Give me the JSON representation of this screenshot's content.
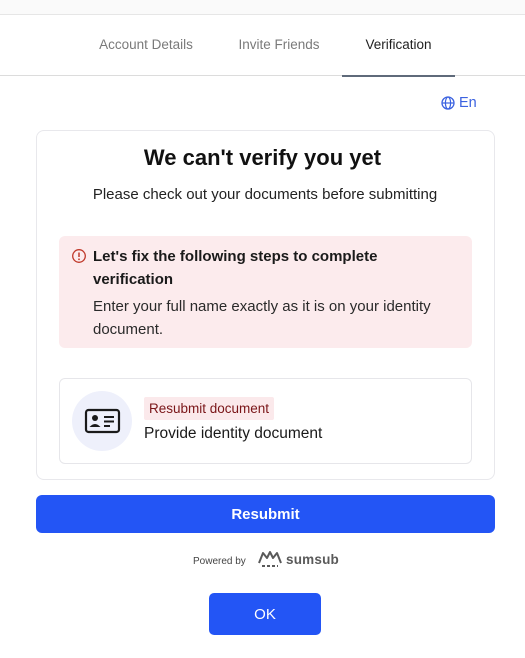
{
  "tabs": [
    {
      "label": "Account Details",
      "active": false
    },
    {
      "label": "Invite Friends",
      "active": false
    },
    {
      "label": "Verification",
      "active": true
    }
  ],
  "language": {
    "icon": "globe-icon",
    "label": "En"
  },
  "status": {
    "title": "We can't verify you yet",
    "subtitle": "Please check out your documents before submitting"
  },
  "alert": {
    "icon": "alert-circle-icon",
    "heading": "Let's fix the following steps to complete verification",
    "text": "Enter your full name exactly as it is on your identity document."
  },
  "document": {
    "icon": "id-card-icon",
    "badge": "Resubmit document",
    "label": "Provide identity document"
  },
  "actions": {
    "resubmit_label": "Resubmit",
    "ok_label": "OK"
  },
  "footer": {
    "powered_by": "Powered by",
    "brand": "sumsub"
  },
  "colors": {
    "accent": "#2355f5",
    "alert_bg": "#fcebed",
    "badge_text": "#7a1518",
    "link": "#3b62e0"
  }
}
